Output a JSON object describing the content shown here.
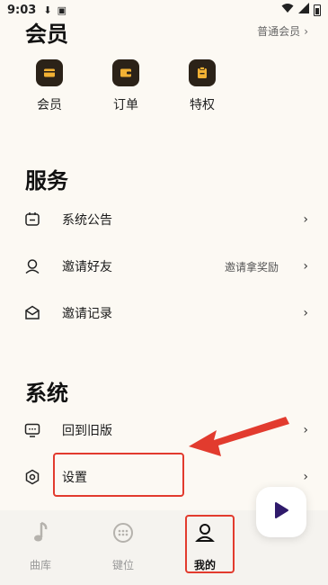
{
  "status": {
    "time": "9:03"
  },
  "member": {
    "title": "会员",
    "level": "普通会员",
    "items": [
      {
        "label": "会员",
        "icon": "card-icon"
      },
      {
        "label": "订单",
        "icon": "wallet-icon"
      },
      {
        "label": "特权",
        "icon": "clipboard-icon"
      }
    ]
  },
  "service": {
    "title": "服务",
    "items": [
      {
        "label": "系统公告",
        "extra": "",
        "icon": "announcement-icon"
      },
      {
        "label": "邀请好友",
        "extra": "邀请拿奖励",
        "icon": "invite-friends-icon"
      },
      {
        "label": "邀请记录",
        "extra": "",
        "icon": "mail-record-icon"
      }
    ]
  },
  "system": {
    "title": "系统",
    "items": [
      {
        "label": "回到旧版",
        "icon": "old-version-icon"
      },
      {
        "label": "设置",
        "icon": "settings-icon"
      }
    ]
  },
  "tabs": [
    {
      "label": "曲库",
      "icon": "music-note-icon",
      "active": false
    },
    {
      "label": "键位",
      "icon": "keypad-icon",
      "active": false
    },
    {
      "label": "我的",
      "icon": "profile-icon",
      "active": true
    }
  ],
  "fab": {
    "icon": "play-icon",
    "color": "#2f1a6b"
  },
  "annotation": {
    "color": "#e23b2e"
  }
}
